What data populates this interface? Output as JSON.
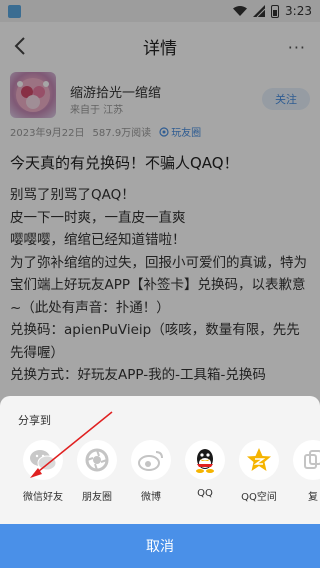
{
  "status_bar": {
    "time": "3:23"
  },
  "header": {
    "title": "详情",
    "more": "···"
  },
  "author": {
    "name": "缩游拾光一绾绾",
    "source": "来自于 江苏",
    "follow_label": "关注"
  },
  "meta": {
    "date": "2023年9月22日",
    "views": "587.9万阅读",
    "tag": "玩友圈"
  },
  "article": {
    "title": "今天真的有兑换码！不骗人QAQ！",
    "paragraphs": [
      "别骂了别骂了QAQ！",
      "皮一下一时爽，一直皮一直爽",
      "嘤嘤嘤，绾绾已经知道错啦！",
      "为了弥补绾绾的过失，回报小可爱们的真诚，特为宝们端上好玩友APP【补签卡】兑换码，以表歉意~（此处有声音：扑通！）",
      "兑换码：apienPuVieip（咳咳，数量有限，先先先得喔）",
      "兑换方式：好玩友APP-我的-工具箱-兑换码"
    ]
  },
  "share": {
    "title": "分享到",
    "items": [
      {
        "label": "微信好友",
        "icon": "wechat-icon"
      },
      {
        "label": "朋友圈",
        "icon": "moments-icon"
      },
      {
        "label": "微博",
        "icon": "weibo-icon"
      },
      {
        "label": "QQ",
        "icon": "qq-icon"
      },
      {
        "label": "QQ空间",
        "icon": "qzone-icon"
      },
      {
        "label": "复",
        "icon": "copy-icon"
      }
    ],
    "cancel_label": "取消"
  },
  "colors": {
    "accent": "#4a90e8",
    "annotation_arrow": "#e02020"
  }
}
